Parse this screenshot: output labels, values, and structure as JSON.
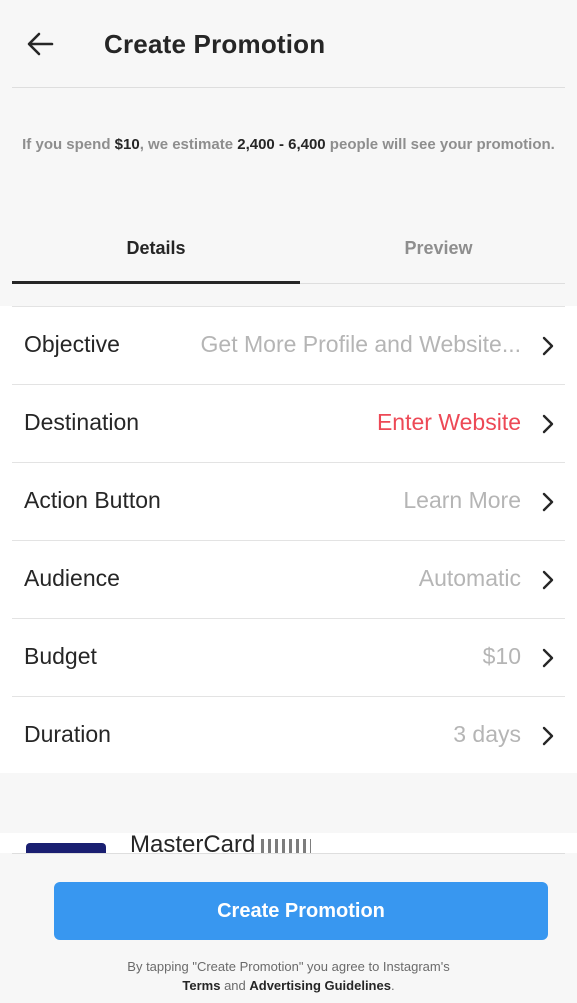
{
  "header": {
    "title": "Create Promotion"
  },
  "estimate": {
    "prefix": "If you spend ",
    "amount": "$10",
    "middle": ", we estimate ",
    "reach": "2,400 - 6,400",
    "suffix": " people will see your promotion."
  },
  "tabs": {
    "details": "Details",
    "preview": "Preview"
  },
  "rows": [
    {
      "label": "Objective",
      "value": "Get More Profile and Website..."
    },
    {
      "label": "Destination",
      "value": "Enter Website"
    },
    {
      "label": "Action Button",
      "value": "Learn More"
    },
    {
      "label": "Audience",
      "value": "Automatic"
    },
    {
      "label": "Budget",
      "value": "$10"
    },
    {
      "label": "Duration",
      "value": "3 days"
    }
  ],
  "payment": {
    "card_name": "MasterCard"
  },
  "cta": {
    "label": "Create Promotion"
  },
  "terms": {
    "prefix": "By tapping \"Create Promotion\" you agree to Instagram's",
    "terms_link": "Terms",
    "and": " and ",
    "guidelines_link": "Advertising Guidelines",
    "end": "."
  },
  "colors": {
    "accent": "#3897f0",
    "error": "#ed4956",
    "muted": "#b5b5b5"
  },
  "icons": {
    "back": "arrow-left-icon",
    "chevron": "chevron-right-icon"
  }
}
